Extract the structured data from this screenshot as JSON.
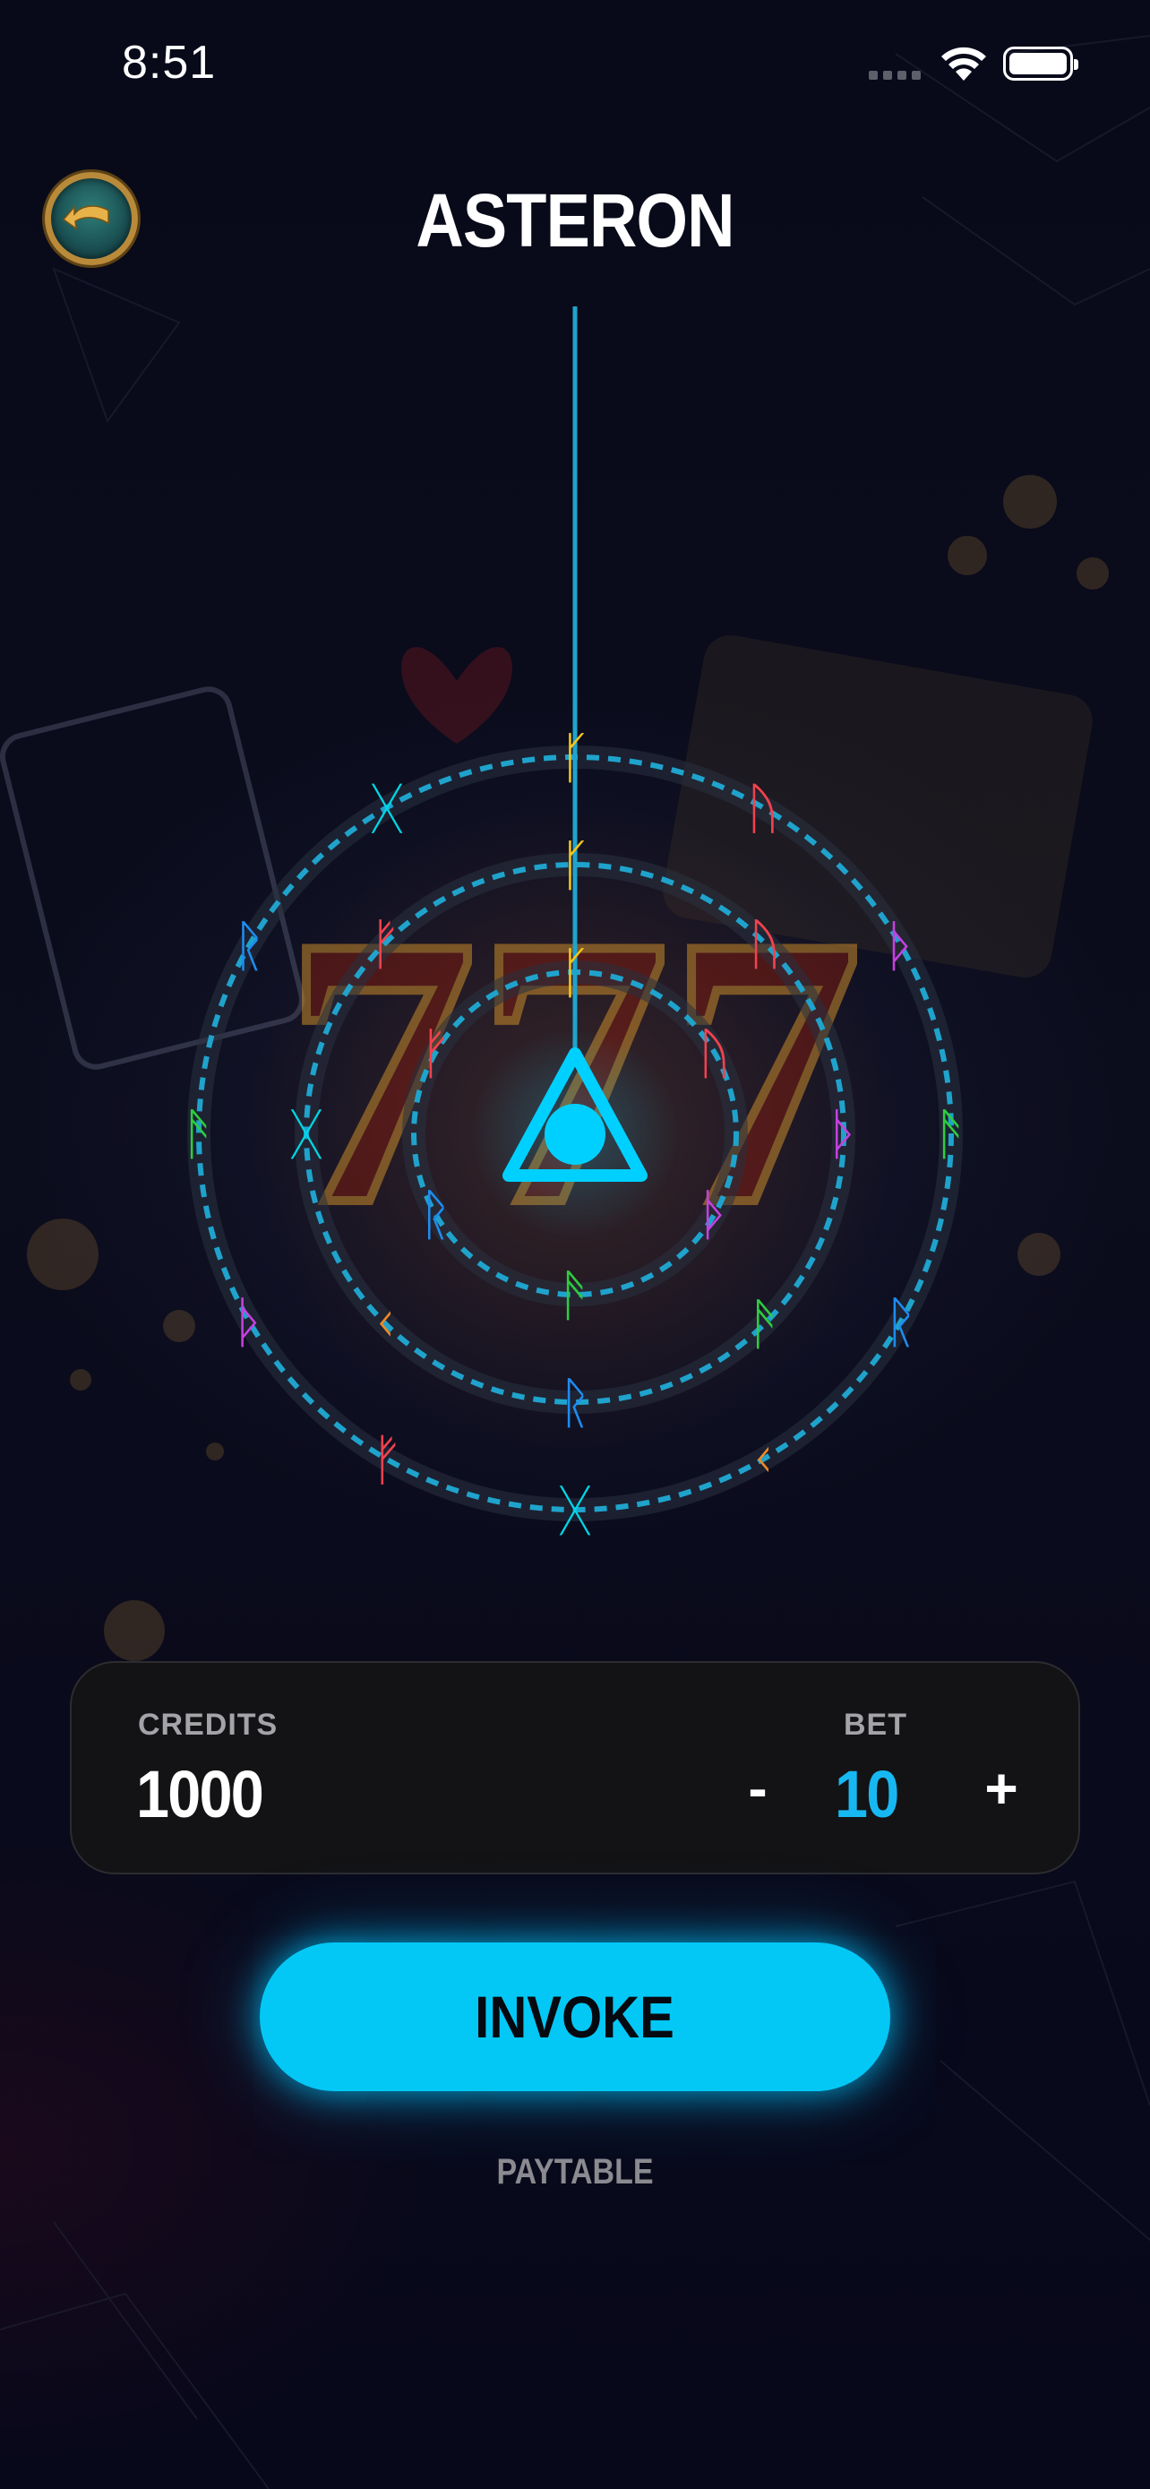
{
  "status_bar": {
    "time": "8:51"
  },
  "header": {
    "title": "ASTERON",
    "back_icon": "back-arrow-icon"
  },
  "wheel": {
    "ring_colors": {
      "ring": "#1fa3cc",
      "glow": "#00c8ff"
    },
    "center_icon": "triangle-eye-icon",
    "rings": [
      {
        "name": "outer",
        "symbols": [
          {
            "glyph": "ᚴ",
            "color": "#f5c518"
          },
          {
            "glyph": "ᚢ",
            "color": "#f0424f"
          },
          {
            "glyph": "ᚦ",
            "color": "#c640e0"
          },
          {
            "glyph": "ᚫ",
            "color": "#2ecc40"
          },
          {
            "glyph": "ᚱ",
            "color": "#1e8cf0"
          },
          {
            "glyph": "ᚲ",
            "color": "#f08a24"
          },
          {
            "glyph": "ᚷ",
            "color": "#00d6e6"
          },
          {
            "glyph": "ᚠ",
            "color": "#f0424f"
          },
          {
            "glyph": "ᚦ",
            "color": "#c640e0"
          },
          {
            "glyph": "ᚫ",
            "color": "#2ecc40"
          },
          {
            "glyph": "ᚱ",
            "color": "#1e8cf0"
          },
          {
            "glyph": "ᚷ",
            "color": "#00d6e6"
          }
        ]
      },
      {
        "name": "middle",
        "symbols": [
          {
            "glyph": "ᚴ",
            "color": "#f5c518"
          },
          {
            "glyph": "ᚢ",
            "color": "#f0424f"
          },
          {
            "glyph": "ᚦ",
            "color": "#c640e0"
          },
          {
            "glyph": "ᚫ",
            "color": "#2ecc40"
          },
          {
            "glyph": "ᚱ",
            "color": "#1e8cf0"
          },
          {
            "glyph": "ᚲ",
            "color": "#f08a24"
          },
          {
            "glyph": "ᚷ",
            "color": "#00d6e6"
          },
          {
            "glyph": "ᚠ",
            "color": "#f0424f"
          }
        ]
      },
      {
        "name": "inner",
        "symbols": [
          {
            "glyph": "ᚴ",
            "color": "#f5c518"
          },
          {
            "glyph": "ᚢ",
            "color": "#f0424f"
          },
          {
            "glyph": "ᚦ",
            "color": "#c640e0"
          },
          {
            "glyph": "ᚫ",
            "color": "#2ecc40"
          },
          {
            "glyph": "ᚱ",
            "color": "#1e8cf0"
          },
          {
            "glyph": "ᚠ",
            "color": "#f0424f"
          }
        ]
      }
    ]
  },
  "panel": {
    "credits_label": "CREDITS",
    "credits_value": "1000",
    "bet_label": "BET",
    "bet_value": "10",
    "bet_minus": "-",
    "bet_plus": "+"
  },
  "actions": {
    "invoke_label": "INVOKE",
    "paytable_label": "PAYTABLE"
  },
  "colors": {
    "accent": "#03c8f6",
    "bet_value": "#17b8f2",
    "background": "#070817"
  }
}
